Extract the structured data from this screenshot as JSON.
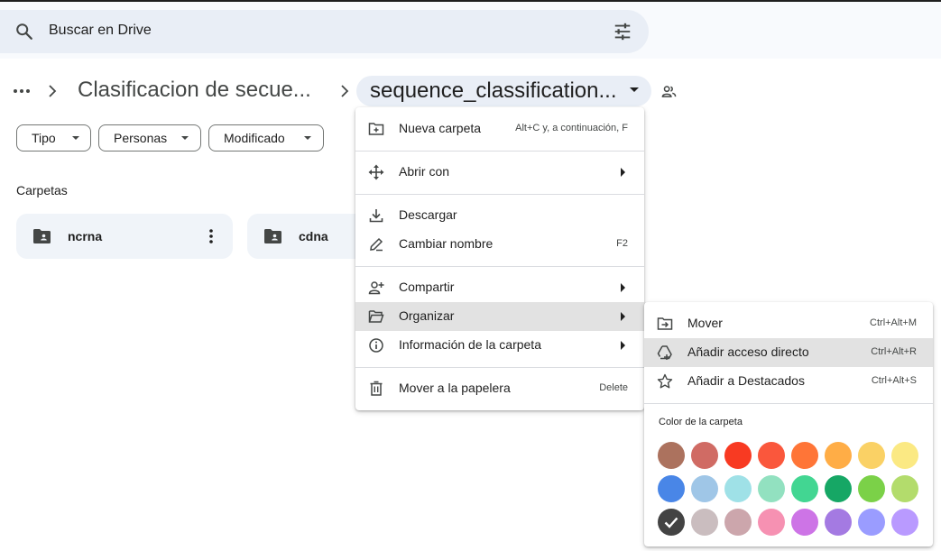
{
  "search": {
    "placeholder": "Buscar en Drive"
  },
  "breadcrumb": {
    "parent": "Clasificacion de secue...",
    "current": "sequence_classification..."
  },
  "filters": [
    {
      "label": "Tipo"
    },
    {
      "label": "Personas"
    },
    {
      "label": "Modificado"
    }
  ],
  "folders_section": {
    "title": "Carpetas",
    "items": [
      {
        "name": "ncrna"
      },
      {
        "name": "cdna"
      }
    ]
  },
  "context_menu": {
    "items": [
      {
        "label": "Nueva carpeta",
        "shortcut": "Alt+C y, a continuación, F",
        "icon": "new-folder-icon"
      },
      {
        "label": "Abrir con",
        "icon": "open-with-icon"
      },
      {
        "label": "Descargar",
        "icon": "download-icon"
      },
      {
        "label": "Cambiar nombre",
        "shortcut": "F2",
        "icon": "rename-icon"
      },
      {
        "label": "Compartir",
        "icon": "share-person-icon"
      },
      {
        "label": "Organizar",
        "icon": "folder-open-icon"
      },
      {
        "label": "Información de la carpeta",
        "icon": "info-icon"
      },
      {
        "label": "Mover a la papelera",
        "shortcut": "Delete",
        "icon": "trash-icon"
      }
    ]
  },
  "organize_submenu": {
    "items": [
      {
        "label": "Mover",
        "shortcut": "Ctrl+Alt+M",
        "icon": "move-icon"
      },
      {
        "label": "Añadir acceso directo",
        "shortcut": "Ctrl+Alt+R",
        "icon": "add-shortcut-icon"
      },
      {
        "label": "Añadir a Destacados",
        "shortcut": "Ctrl+Alt+S",
        "icon": "star-icon"
      }
    ],
    "color_title": "Color de la carpeta",
    "colors": [
      [
        "#ac725e",
        "#d06b64",
        "#f83a22",
        "#fa573c",
        "#ff7537",
        "#ffad46",
        "#fad165",
        "#fbe983"
      ],
      [
        "#4986e7",
        "#9fc6e7",
        "#9fe1e7",
        "#92e1c0",
        "#42d692",
        "#16a765",
        "#7bd148",
        "#b3dc6c"
      ],
      [
        "#434343",
        "#cabdbf",
        "#cca6ac",
        "#f691b2",
        "#cd74e6",
        "#a47ae2",
        "#9a9cff",
        "#b99aff"
      ]
    ],
    "selected_color": "#434343"
  }
}
